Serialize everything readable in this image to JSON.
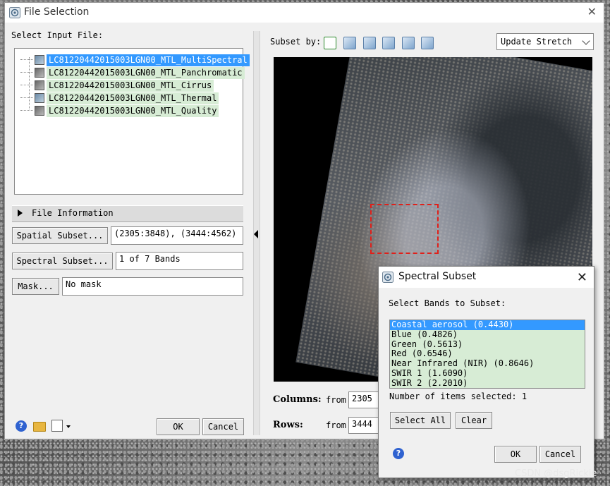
{
  "window": {
    "title": "File Selection"
  },
  "input": {
    "heading": "Select Input File:",
    "files": [
      {
        "name": "LC81220442015003LGN00_MTL_MultiSpectral",
        "selected": true
      },
      {
        "name": "LC81220442015003LGN00_MTL_Panchromatic",
        "selected": false
      },
      {
        "name": "LC81220442015003LGN00_MTL_Cirrus",
        "selected": false
      },
      {
        "name": "LC81220442015003LGN00_MTL_Thermal",
        "selected": false
      },
      {
        "name": "LC81220442015003LGN00_MTL_Quality",
        "selected": false
      }
    ]
  },
  "file_info": {
    "label": "File Information"
  },
  "spatial": {
    "button": "Spatial Subset...",
    "value": "(2305:3848), (3444:4562)"
  },
  "spectral": {
    "button": "Spectral Subset...",
    "value": "1 of 7 Bands"
  },
  "mask": {
    "button": "Mask...",
    "value": "No mask"
  },
  "footer": {
    "ok": "OK",
    "cancel": "Cancel"
  },
  "subset": {
    "label": "Subset by:",
    "stretch_value": "Update Stretch"
  },
  "coords": {
    "columns_label": "Columns:",
    "rows_label": "Rows:",
    "from_label": "from",
    "columns_from": "2305",
    "rows_from": "3444"
  },
  "spectral_dialog": {
    "title": "Spectral Subset",
    "heading": "Select Bands to Subset:",
    "bands": [
      "Coastal aerosol (0.4430)",
      "Blue (0.4826)",
      "Green (0.5613)",
      "Red (0.6546)",
      "Near Infrared (NIR) (0.8646)",
      "SWIR 1 (1.6090)",
      "SWIR 2 (2.2010)"
    ],
    "selected_index": 0,
    "count_text": "Number of items selected: 1",
    "select_all": "Select All",
    "clear": "Clear",
    "ok": "OK",
    "cancel": "Cancel"
  },
  "watermark": "CSDN @dsgRickie",
  "colors": {
    "selection": "#3399ff",
    "list_bg": "#d7ecd5",
    "roi": "#e0201a"
  }
}
